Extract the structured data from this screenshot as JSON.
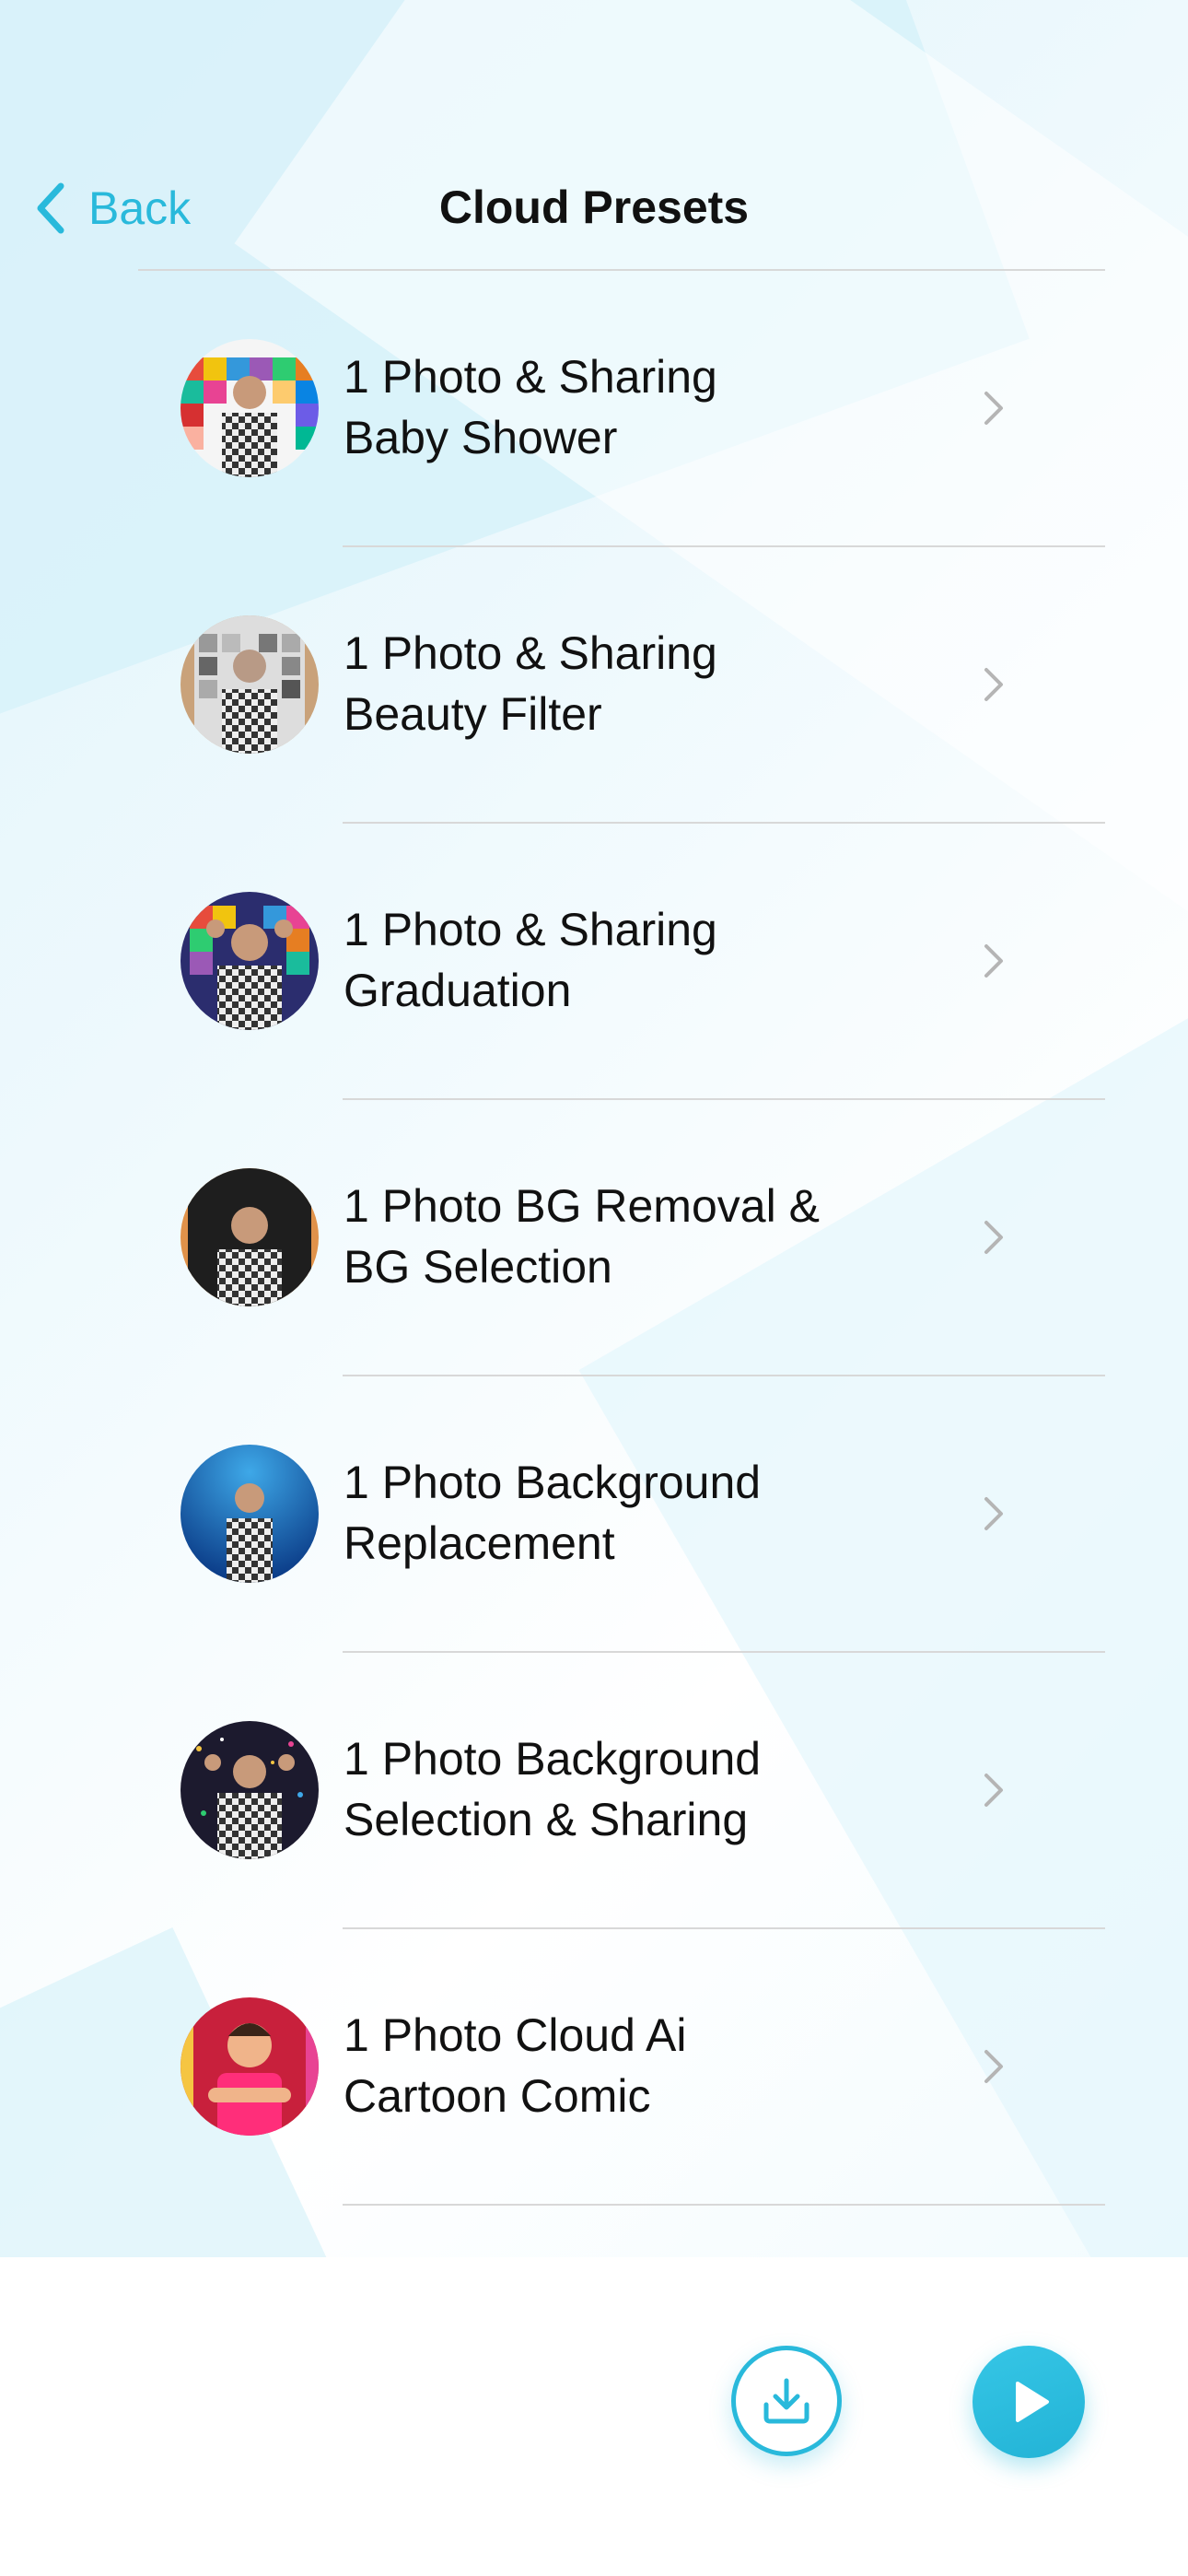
{
  "nav": {
    "back_label": "Back",
    "title": "Cloud Presets"
  },
  "colors": {
    "accent": "#29b9db",
    "divider": "#d8d8d8"
  },
  "presets": [
    {
      "line1": "1 Photo & Sharing",
      "line2": "Baby Shower",
      "thumb": "colorful-tiles"
    },
    {
      "line1": "1 Photo & Sharing",
      "line2": "Beauty Filter",
      "thumb": "gray-tiles"
    },
    {
      "line1": "1 Photo & Sharing",
      "line2": "Graduation",
      "thumb": "colorful-tiles-hands"
    },
    {
      "line1": "1 Photo BG Removal &",
      "line2": "BG Selection",
      "thumb": "black-background"
    },
    {
      "line1": "1 Photo Background",
      "line2": "Replacement",
      "thumb": "underwater"
    },
    {
      "line1": "1 Photo Background",
      "line2": "Selection & Sharing",
      "thumb": "confetti-dark"
    },
    {
      "line1": "1 Photo Cloud Ai",
      "line2": "Cartoon Comic",
      "thumb": "cartoon-red"
    }
  ],
  "toolbar": {
    "download_icon": "download-icon",
    "play_icon": "play-icon"
  }
}
